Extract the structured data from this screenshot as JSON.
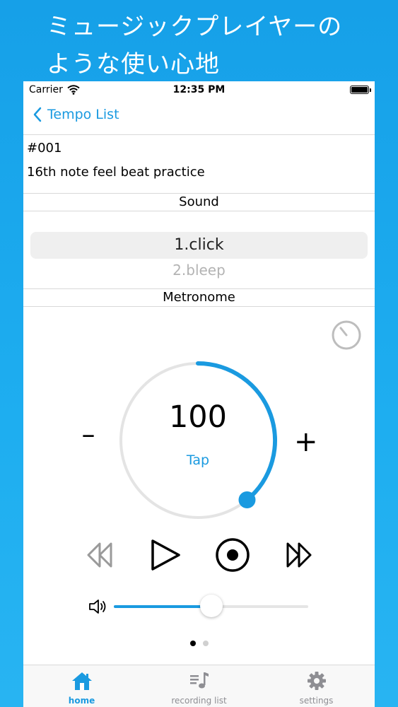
{
  "promo": {
    "line1": "ミュージックプレイヤーの",
    "line2": "ような使い心地"
  },
  "status_bar": {
    "carrier": "Carrier",
    "time": "12:35 PM"
  },
  "nav": {
    "back_label": "Tempo List"
  },
  "tempo": {
    "number": "#001",
    "title": "16th note feel beat practice"
  },
  "sound": {
    "label": "Sound",
    "options": [
      "1.click",
      "2.bleep"
    ],
    "selected": "1.click"
  },
  "metronome": {
    "label": "Metronome",
    "bpm": "100",
    "tap_label": "Tap",
    "minus_label": "–",
    "plus_label": "+",
    "dial_progress": 0.39
  },
  "volume": {
    "level": 0.5
  },
  "pager": {
    "pages": 2,
    "current": 0
  },
  "tabbar": {
    "tabs": [
      {
        "label": "home",
        "icon": "home-icon",
        "active": true
      },
      {
        "label": "recording list",
        "icon": "music-list-icon",
        "active": false
      },
      {
        "label": "settings",
        "icon": "gear-icon",
        "active": false
      }
    ]
  },
  "colors": {
    "accent": "#1a9ae0",
    "background": "#1ea8ee"
  }
}
